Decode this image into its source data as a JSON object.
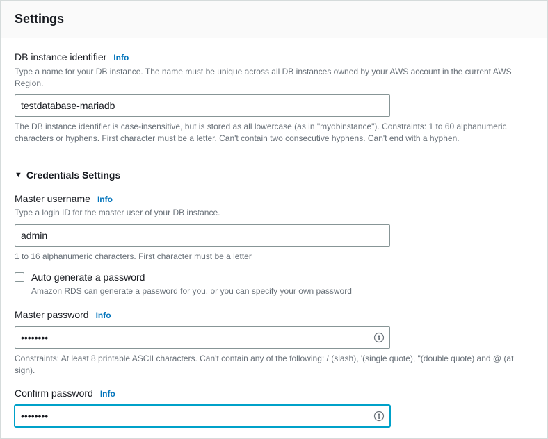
{
  "panel": {
    "title": "Settings"
  },
  "info_label": "Info",
  "dbIdentifier": {
    "label": "DB instance identifier",
    "help": "Type a name for your DB instance. The name must be unique across all DB instances owned by your AWS account in the current AWS Region.",
    "value": "testdatabase-mariadb",
    "constraints": "The DB instance identifier is case-insensitive, but is stored as all lowercase (as in \"mydbinstance\"). Constraints: 1 to 60 alphanumeric characters or hyphens. First character must be a letter. Can't contain two consecutive hyphens. Can't end with a hyphen."
  },
  "credentials": {
    "section_title": "Credentials Settings",
    "username": {
      "label": "Master username",
      "help": "Type a login ID for the master user of your DB instance.",
      "value": "admin",
      "constraints": "1 to 16 alphanumeric characters. First character must be a letter"
    },
    "autogen": {
      "label": "Auto generate a password",
      "help": "Amazon RDS can generate a password for you, or you can specify your own password"
    },
    "password": {
      "label": "Master password",
      "value": "••••••••",
      "constraints": "Constraints: At least 8 printable ASCII characters. Can't contain any of the following: / (slash), '(single quote), \"(double quote) and @ (at sign)."
    },
    "confirm": {
      "label": "Confirm password",
      "value": "••••••••"
    }
  }
}
